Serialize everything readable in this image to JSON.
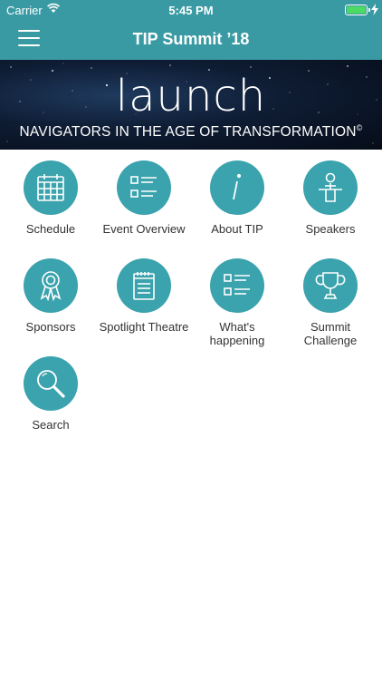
{
  "status_bar": {
    "carrier": "Carrier",
    "time": "5:45 PM"
  },
  "nav": {
    "title": "TIP Summit ’18"
  },
  "banner": {
    "logo": "launch",
    "tagline": "NAVIGATORS IN THE AGE OF TRANSFORMATION",
    "copyright": "©"
  },
  "colors": {
    "nav_bg": "#3a9aa3",
    "tile_bg": "#3aa3ad",
    "battery": "#4cd964"
  },
  "tiles": [
    {
      "label": "Schedule",
      "icon": "calendar-icon"
    },
    {
      "label": "Event Overview",
      "icon": "list-icon"
    },
    {
      "label": "About TIP",
      "icon": "info-icon"
    },
    {
      "label": "Speakers",
      "icon": "speaker-podium-icon"
    },
    {
      "label": "Sponsors",
      "icon": "award-ribbon-icon"
    },
    {
      "label": "Spotlight Theatre",
      "icon": "notepad-icon"
    },
    {
      "label": "What's happening",
      "icon": "list-icon"
    },
    {
      "label": "Summit Challenge",
      "icon": "trophy-icon"
    },
    {
      "label": "Search",
      "icon": "search-icon"
    }
  ]
}
